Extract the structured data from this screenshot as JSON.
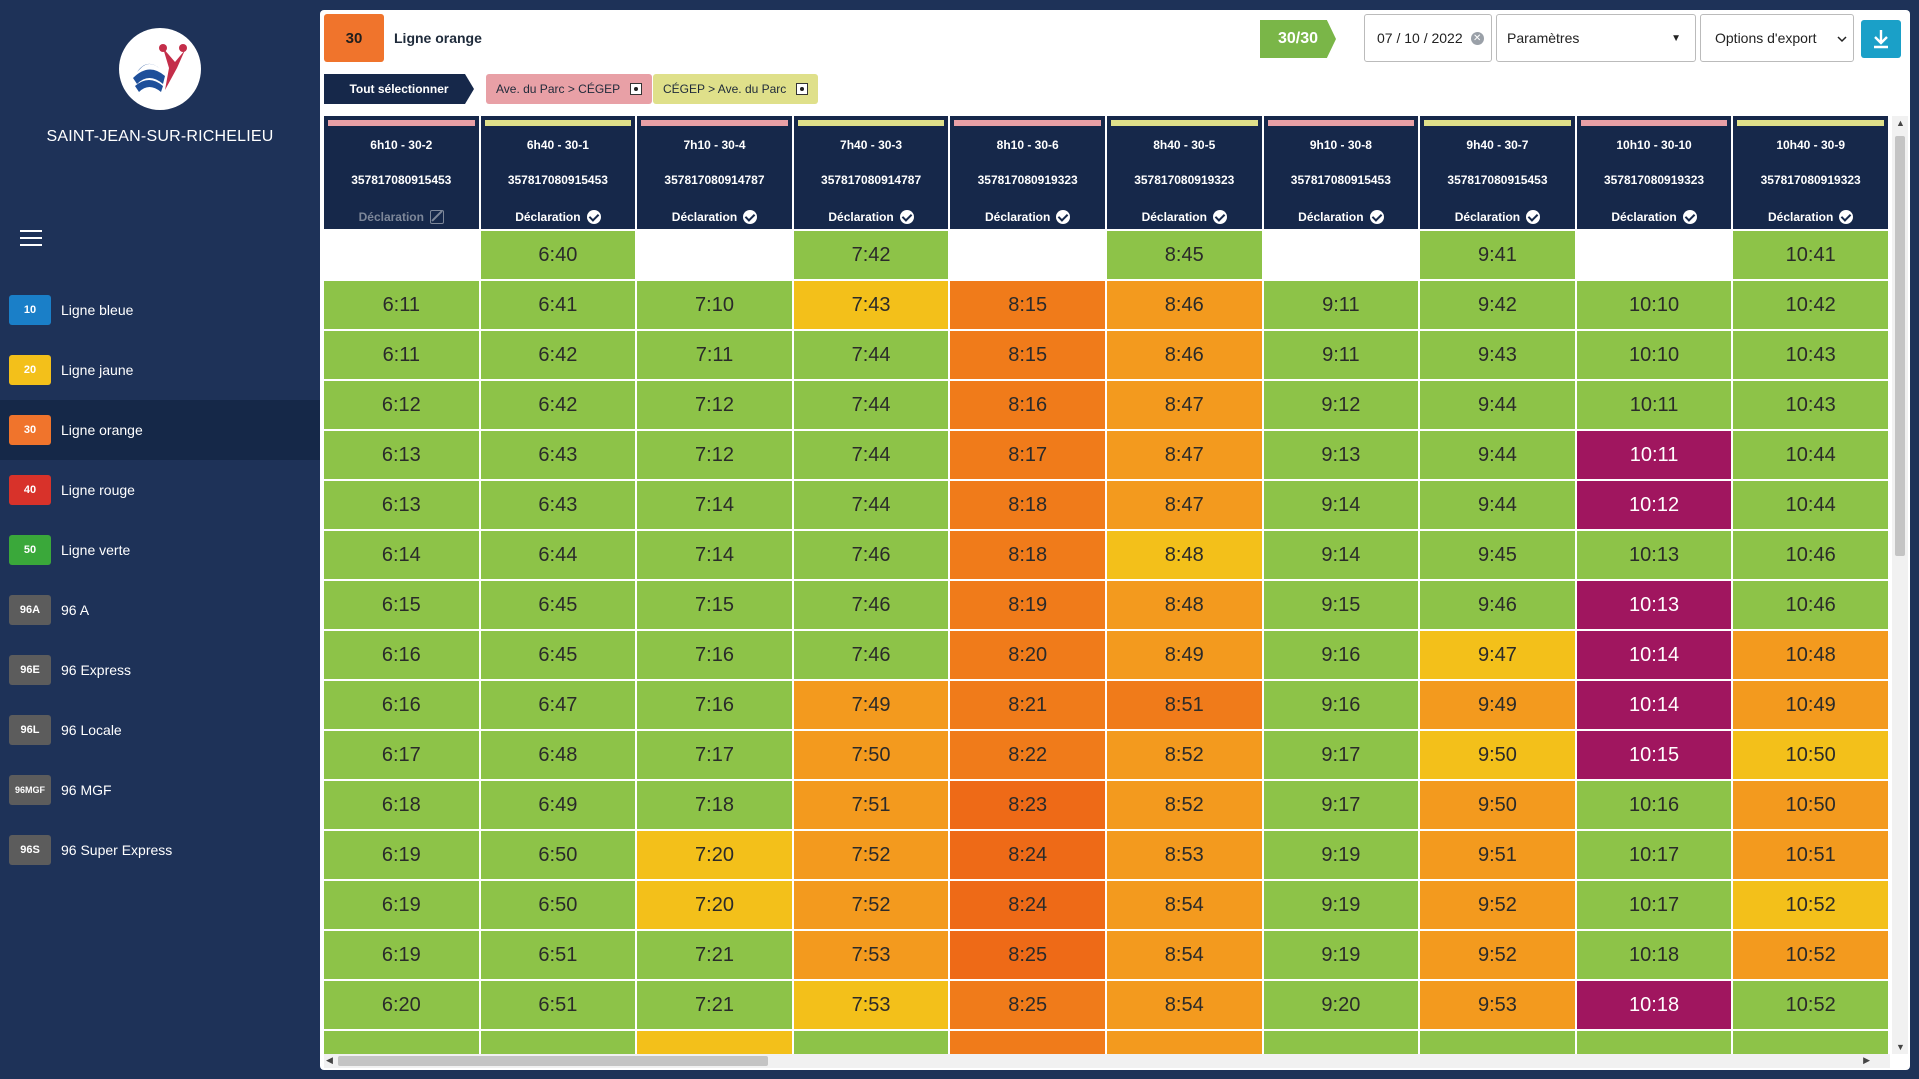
{
  "sidebar": {
    "city": "SAINT-JEAN-SUR-RICHELIEU",
    "items": [
      {
        "badge": "10",
        "label": "Ligne bleue",
        "color": "#1a7fc8"
      },
      {
        "badge": "20",
        "label": "Ligne jaune",
        "color": "#f3c01a"
      },
      {
        "badge": "30",
        "label": "Ligne orange",
        "color": "#f0742c",
        "active": true
      },
      {
        "badge": "40",
        "label": "Ligne rouge",
        "color": "#d8322a"
      },
      {
        "badge": "50",
        "label": "Ligne verte",
        "color": "#3aa83a"
      },
      {
        "badge": "96A",
        "label": "96 A",
        "color": "#5c5c5c"
      },
      {
        "badge": "96E",
        "label": "96 Express",
        "color": "#5c5c5c"
      },
      {
        "badge": "96L",
        "label": "96 Locale",
        "color": "#5c5c5c"
      },
      {
        "badge": "96MGF",
        "label": "96 MGF",
        "color": "#5c5c5c"
      },
      {
        "badge": "96S",
        "label": "96 Super Express",
        "color": "#5c5c5c"
      }
    ]
  },
  "header": {
    "line_number": "30",
    "line_name": "Ligne orange",
    "count": "30/30",
    "date": "07 / 10 / 2022",
    "params_label": "Paramètres",
    "export_label": "Options d'export"
  },
  "filters": {
    "select_all": "Tout sélectionner",
    "chips": [
      {
        "label": "Ave. du Parc > CÉGEP",
        "color": "#e8a0a6"
      },
      {
        "label": "CÉGEP > Ave. du Parc",
        "color": "#dfe08a"
      }
    ]
  },
  "colors": {
    "green": "#8dc348",
    "yellow": "#f3c01a",
    "light_orange": "#f5a623",
    "orange": "#f39a1e",
    "dark_orange": "#f07b1a",
    "red_orange": "#ee6a17",
    "magenta": "#a0165f",
    "dir_a_bar": "#e8a0a6",
    "dir_b_bar": "#dfe08a"
  },
  "columns": [
    {
      "trip": "6h10 - 30-2",
      "bus": "357817080915453",
      "declaration": "Déclaration",
      "declared": false,
      "dir": "a"
    },
    {
      "trip": "6h40 - 30-1",
      "bus": "357817080915453",
      "declaration": "Déclaration",
      "declared": true,
      "dir": "b"
    },
    {
      "trip": "7h10 - 30-4",
      "bus": "357817080914787",
      "declaration": "Déclaration",
      "declared": true,
      "dir": "a"
    },
    {
      "trip": "7h40 - 30-3",
      "bus": "357817080914787",
      "declaration": "Déclaration",
      "declared": true,
      "dir": "b"
    },
    {
      "trip": "8h10 - 30-6",
      "bus": "357817080919323",
      "declaration": "Déclaration",
      "declared": true,
      "dir": "a"
    },
    {
      "trip": "8h40 - 30-5",
      "bus": "357817080919323",
      "declaration": "Déclaration",
      "declared": true,
      "dir": "b"
    },
    {
      "trip": "9h10 - 30-8",
      "bus": "357817080915453",
      "declaration": "Déclaration",
      "declared": true,
      "dir": "a"
    },
    {
      "trip": "9h40 - 30-7",
      "bus": "357817080915453",
      "declaration": "Déclaration",
      "declared": true,
      "dir": "b"
    },
    {
      "trip": "10h10 - 30-10",
      "bus": "357817080919323",
      "declaration": "Déclaration",
      "declared": true,
      "dir": "a"
    },
    {
      "trip": "10h40 - 30-9",
      "bus": "357817080919323",
      "declaration": "Déclaration",
      "declared": true,
      "dir": "b"
    }
  ],
  "rows": [
    [
      [
        "",
        "w"
      ],
      [
        "6:40",
        "g"
      ],
      [
        "",
        "w"
      ],
      [
        "7:42",
        "g"
      ],
      [
        "",
        "w"
      ],
      [
        "8:45",
        "g"
      ],
      [
        "",
        "w"
      ],
      [
        "9:41",
        "g"
      ],
      [
        "",
        "w"
      ],
      [
        "10:41",
        "g"
      ]
    ],
    [
      [
        "6:11",
        "g"
      ],
      [
        "6:41",
        "g"
      ],
      [
        "7:10",
        "g"
      ],
      [
        "7:43",
        "y"
      ],
      [
        "8:15",
        "do"
      ],
      [
        "8:46",
        "o"
      ],
      [
        "9:11",
        "g"
      ],
      [
        "9:42",
        "g"
      ],
      [
        "10:10",
        "g"
      ],
      [
        "10:42",
        "g"
      ]
    ],
    [
      [
        "6:11",
        "g"
      ],
      [
        "6:42",
        "g"
      ],
      [
        "7:11",
        "g"
      ],
      [
        "7:44",
        "g"
      ],
      [
        "8:15",
        "do"
      ],
      [
        "8:46",
        "o"
      ],
      [
        "9:11",
        "g"
      ],
      [
        "9:43",
        "g"
      ],
      [
        "10:10",
        "g"
      ],
      [
        "10:43",
        "g"
      ]
    ],
    [
      [
        "6:12",
        "g"
      ],
      [
        "6:42",
        "g"
      ],
      [
        "7:12",
        "g"
      ],
      [
        "7:44",
        "g"
      ],
      [
        "8:16",
        "do"
      ],
      [
        "8:47",
        "o"
      ],
      [
        "9:12",
        "g"
      ],
      [
        "9:44",
        "g"
      ],
      [
        "10:11",
        "g"
      ],
      [
        "10:43",
        "g"
      ]
    ],
    [
      [
        "6:13",
        "g"
      ],
      [
        "6:43",
        "g"
      ],
      [
        "7:12",
        "g"
      ],
      [
        "7:44",
        "g"
      ],
      [
        "8:17",
        "do"
      ],
      [
        "8:47",
        "o"
      ],
      [
        "9:13",
        "g"
      ],
      [
        "9:44",
        "g"
      ],
      [
        "10:11",
        "m"
      ],
      [
        "10:44",
        "g"
      ]
    ],
    [
      [
        "6:13",
        "g"
      ],
      [
        "6:43",
        "g"
      ],
      [
        "7:14",
        "g"
      ],
      [
        "7:44",
        "g"
      ],
      [
        "8:18",
        "do"
      ],
      [
        "8:47",
        "o"
      ],
      [
        "9:14",
        "g"
      ],
      [
        "9:44",
        "g"
      ],
      [
        "10:12",
        "m"
      ],
      [
        "10:44",
        "g"
      ]
    ],
    [
      [
        "6:14",
        "g"
      ],
      [
        "6:44",
        "g"
      ],
      [
        "7:14",
        "g"
      ],
      [
        "7:46",
        "g"
      ],
      [
        "8:18",
        "do"
      ],
      [
        "8:48",
        "y"
      ],
      [
        "9:14",
        "g"
      ],
      [
        "9:45",
        "g"
      ],
      [
        "10:13",
        "g"
      ],
      [
        "10:46",
        "g"
      ]
    ],
    [
      [
        "6:15",
        "g"
      ],
      [
        "6:45",
        "g"
      ],
      [
        "7:15",
        "g"
      ],
      [
        "7:46",
        "g"
      ],
      [
        "8:19",
        "do"
      ],
      [
        "8:48",
        "o"
      ],
      [
        "9:15",
        "g"
      ],
      [
        "9:46",
        "g"
      ],
      [
        "10:13",
        "m"
      ],
      [
        "10:46",
        "g"
      ]
    ],
    [
      [
        "6:16",
        "g"
      ],
      [
        "6:45",
        "g"
      ],
      [
        "7:16",
        "g"
      ],
      [
        "7:46",
        "g"
      ],
      [
        "8:20",
        "do"
      ],
      [
        "8:49",
        "o"
      ],
      [
        "9:16",
        "g"
      ],
      [
        "9:47",
        "y"
      ],
      [
        "10:14",
        "m"
      ],
      [
        "10:48",
        "o"
      ]
    ],
    [
      [
        "6:16",
        "g"
      ],
      [
        "6:47",
        "g"
      ],
      [
        "7:16",
        "g"
      ],
      [
        "7:49",
        "o"
      ],
      [
        "8:21",
        "do"
      ],
      [
        "8:51",
        "do"
      ],
      [
        "9:16",
        "g"
      ],
      [
        "9:49",
        "o"
      ],
      [
        "10:14",
        "m"
      ],
      [
        "10:49",
        "o"
      ]
    ],
    [
      [
        "6:17",
        "g"
      ],
      [
        "6:48",
        "g"
      ],
      [
        "7:17",
        "g"
      ],
      [
        "7:50",
        "o"
      ],
      [
        "8:22",
        "do"
      ],
      [
        "8:52",
        "o"
      ],
      [
        "9:17",
        "g"
      ],
      [
        "9:50",
        "y"
      ],
      [
        "10:15",
        "m"
      ],
      [
        "10:50",
        "y"
      ]
    ],
    [
      [
        "6:18",
        "g"
      ],
      [
        "6:49",
        "g"
      ],
      [
        "7:18",
        "g"
      ],
      [
        "7:51",
        "o"
      ],
      [
        "8:23",
        "ro"
      ],
      [
        "8:52",
        "o"
      ],
      [
        "9:17",
        "g"
      ],
      [
        "9:50",
        "o"
      ],
      [
        "10:16",
        "g"
      ],
      [
        "10:50",
        "o"
      ]
    ],
    [
      [
        "6:19",
        "g"
      ],
      [
        "6:50",
        "g"
      ],
      [
        "7:20",
        "y"
      ],
      [
        "7:52",
        "o"
      ],
      [
        "8:24",
        "ro"
      ],
      [
        "8:53",
        "o"
      ],
      [
        "9:19",
        "g"
      ],
      [
        "9:51",
        "o"
      ],
      [
        "10:17",
        "g"
      ],
      [
        "10:51",
        "o"
      ]
    ],
    [
      [
        "6:19",
        "g"
      ],
      [
        "6:50",
        "g"
      ],
      [
        "7:20",
        "y"
      ],
      [
        "7:52",
        "o"
      ],
      [
        "8:24",
        "ro"
      ],
      [
        "8:54",
        "o"
      ],
      [
        "9:19",
        "g"
      ],
      [
        "9:52",
        "o"
      ],
      [
        "10:17",
        "g"
      ],
      [
        "10:52",
        "y"
      ]
    ],
    [
      [
        "6:19",
        "g"
      ],
      [
        "6:51",
        "g"
      ],
      [
        "7:21",
        "g"
      ],
      [
        "7:53",
        "o"
      ],
      [
        "8:25",
        "ro"
      ],
      [
        "8:54",
        "o"
      ],
      [
        "9:19",
        "g"
      ],
      [
        "9:52",
        "o"
      ],
      [
        "10:18",
        "g"
      ],
      [
        "10:52",
        "o"
      ]
    ],
    [
      [
        "6:20",
        "g"
      ],
      [
        "6:51",
        "g"
      ],
      [
        "7:21",
        "g"
      ],
      [
        "7:53",
        "y"
      ],
      [
        "8:25",
        "do"
      ],
      [
        "8:54",
        "o"
      ],
      [
        "9:20",
        "g"
      ],
      [
        "9:53",
        "o"
      ],
      [
        "10:18",
        "m"
      ],
      [
        "10:52",
        "g"
      ]
    ],
    [
      [
        "",
        "g"
      ],
      [
        "",
        "g"
      ],
      [
        "",
        "y"
      ],
      [
        "",
        "g"
      ],
      [
        "",
        "do"
      ],
      [
        "",
        "o"
      ],
      [
        "",
        "g"
      ],
      [
        "",
        "g"
      ],
      [
        "",
        "g"
      ],
      [
        "",
        "g"
      ]
    ]
  ]
}
